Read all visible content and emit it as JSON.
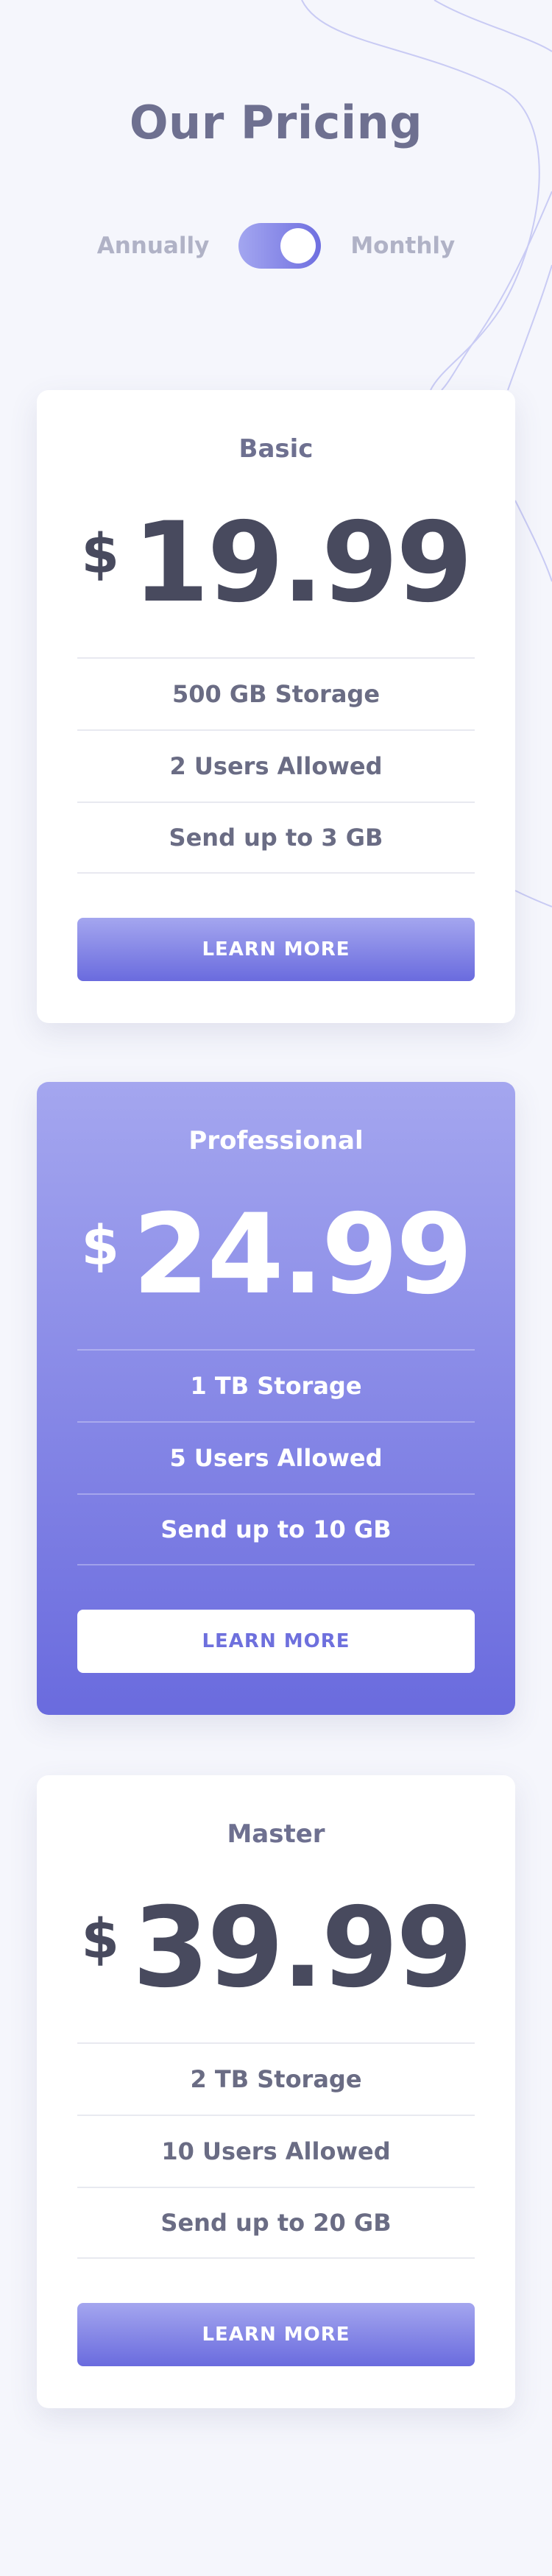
{
  "page": {
    "title": "Our Pricing"
  },
  "billing_toggle": {
    "left_label": "Annually",
    "right_label": "Monthly",
    "selected": "Monthly"
  },
  "plans": [
    {
      "name": "Basic",
      "currency": "$",
      "price": "19.99",
      "features": [
        "500 GB Storage",
        "2 Users Allowed",
        "Send up to 3 GB"
      ],
      "button_label": "LEARN MORE"
    },
    {
      "name": "Professional",
      "currency": "$",
      "price": "24.99",
      "features": [
        "1 TB Storage",
        "5 Users Allowed",
        "Send up to 10 GB"
      ],
      "button_label": "LEARN MORE"
    },
    {
      "name": "Master",
      "currency": "$",
      "price": "39.99",
      "features": [
        "2 TB Storage",
        "10 Users Allowed",
        "Send up to 20 GB"
      ],
      "button_label": "LEARN MORE"
    }
  ],
  "colors": {
    "background": "#f5f6fc",
    "accent_light": "#a4a6ef",
    "accent_dark": "#6a6bde",
    "heading": "#6e7090",
    "price_text": "#484a5e"
  }
}
